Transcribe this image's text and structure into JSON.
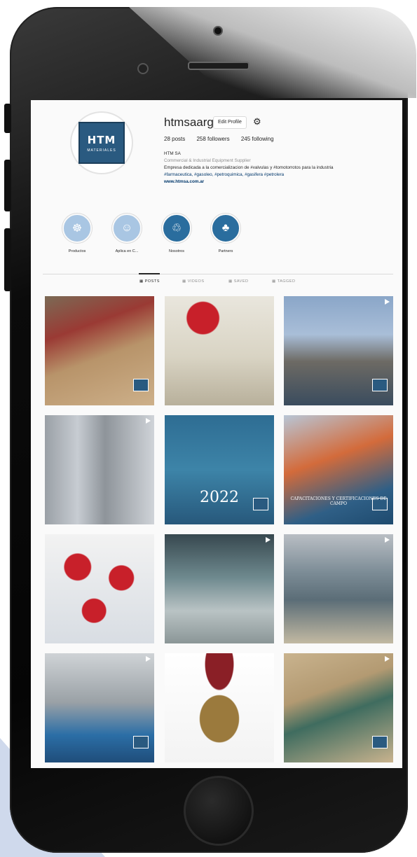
{
  "profile": {
    "username": "htmsaarg",
    "edit_label": "Edit Profile",
    "stats": {
      "posts": "28 posts",
      "followers": "258 followers",
      "following": "245 following"
    },
    "name": "HTM SA",
    "category": "Commercial & Industrial Equipment Supplier",
    "bio_line1": "Empresa dedicada a la comercializacion de #valvulas y #tomotorrotos para la industria",
    "bio_line2": "#farmaceutica, #gasoleo, #petroquimica, #gasifera #petrolera",
    "website": "www.htmsa.com.ar",
    "logo_text": "HTM",
    "logo_sub": "MATERIALES"
  },
  "highlights": [
    {
      "label": "Productos",
      "color": "#a9c6e3"
    },
    {
      "label": "Aplica en C...",
      "color": "#a9c6e3"
    },
    {
      "label": "Nosotros",
      "color": "#2a6d9e"
    },
    {
      "label": "Partners",
      "color": "#2a6d9e"
    }
  ],
  "tabs": [
    {
      "label": "POSTS",
      "active": true
    },
    {
      "label": "VIDEOS",
      "active": false
    },
    {
      "label": "SAVED",
      "active": false
    },
    {
      "label": "TAGGED",
      "active": false
    }
  ],
  "posts": [
    {
      "name": "post-red-pump",
      "bg": "linear-gradient(160deg,#7b6a55 0%,#9a3a34 30%,#b8946a 55%,#cdb08a 100%)",
      "video": false,
      "logo": true,
      "text": ""
    },
    {
      "name": "post-white-valve",
      "bg": "radial-gradient(circle at 35% 20%,#c8202a 0 14%,transparent 15%),linear-gradient(180deg,#e9e6dd 0%,#d9d4c4 55%,#b8b09b 100%)",
      "video": false,
      "logo": false,
      "text": ""
    },
    {
      "name": "post-workers-pipe",
      "bg": "linear-gradient(180deg,#8aa6c8 0%,#a9bed8 35%,#6d6a64 60%,#3a4c5e 100%)",
      "video": true,
      "logo": true,
      "text": ""
    },
    {
      "name": "post-wellhead",
      "bg": "linear-gradient(90deg,#9aa0a6 0%,#c7ccd2 30%,#8e949a 55%,#cfd3d8 100%)",
      "video": true,
      "logo": false,
      "text": ""
    },
    {
      "name": "post-feliz-2022",
      "bg": "linear-gradient(180deg,#2e6d93 0%,#3d84a8 50%,#27587b 100%)",
      "video": false,
      "logo": true,
      "text": "2022"
    },
    {
      "name": "post-capacitaciones",
      "bg": "linear-gradient(160deg,#b8c6d6 0%,#d36b3b 40%,#2f5f86 75%,#1e4a6e 100%)",
      "video": false,
      "logo": true,
      "text": "CAPACITACIONES Y CERTIFICACIONES DE CAMPO"
    },
    {
      "name": "post-red-valves",
      "bg": "radial-gradient(circle at 30% 30%,#c8202a 0 12%,transparent 13%),radial-gradient(circle at 70% 40%,#c8202a 0 12%,transparent 13%),radial-gradient(circle at 45% 70%,#c8202a 0 12%,transparent 13%),linear-gradient(180deg,#f2f2f2,#d8dde3)",
      "video": false,
      "logo": false,
      "text": ""
    },
    {
      "name": "post-gate-valves-row",
      "bg": "linear-gradient(180deg,#37484f 0%,#6f8a8f 40%,#b9c3c4 70%,#8b9697 100%)",
      "video": true,
      "logo": false,
      "text": ""
    },
    {
      "name": "post-pipeline-field",
      "bg": "linear-gradient(180deg,#b9bec4 0%,#7c8c96 35%,#5b6d77 60%,#c2b9a2 100%)",
      "video": true,
      "logo": false,
      "text": ""
    },
    {
      "name": "post-workshop",
      "bg": "linear-gradient(180deg,#cfd3d6 0%,#9aa1a6 45%,#2b6ea6 75%,#1f4d7a 100%)",
      "video": true,
      "logo": true,
      "text": ""
    },
    {
      "name": "post-bronze-valve",
      "bg": "radial-gradient(ellipse at 50% 10%,#8a1f26 0 18%,transparent 19%),radial-gradient(ellipse at 50% 60%,#9b7a3d 0 25%,transparent 26%),linear-gradient(180deg,#ffffff,#f3f3f3)",
      "video": false,
      "logo": false,
      "text": ""
    },
    {
      "name": "post-green-valve",
      "bg": "linear-gradient(160deg,#c9b38e 0%,#b39a72 35%,#3f6c5f 55%,#c9b38e 100%)",
      "video": true,
      "logo": true,
      "text": ""
    }
  ]
}
